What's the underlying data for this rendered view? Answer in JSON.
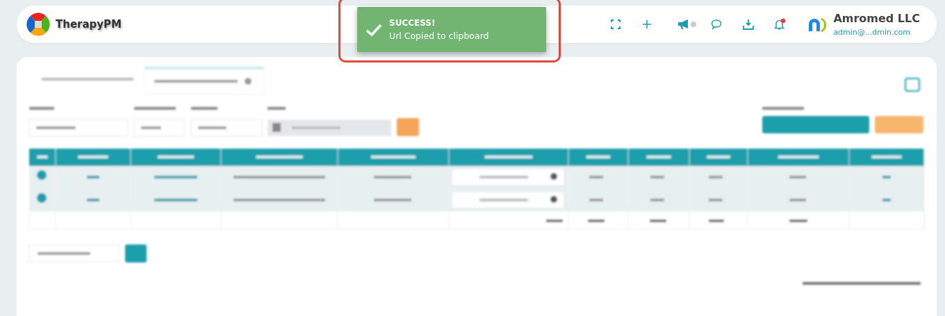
{
  "header": {
    "brand": "TherapyPM",
    "company": "Amromed LLC",
    "email": "admin@...dmin.com"
  },
  "toast": {
    "title": "SUCCESS!",
    "message": "Url Copied to clipboard"
  }
}
